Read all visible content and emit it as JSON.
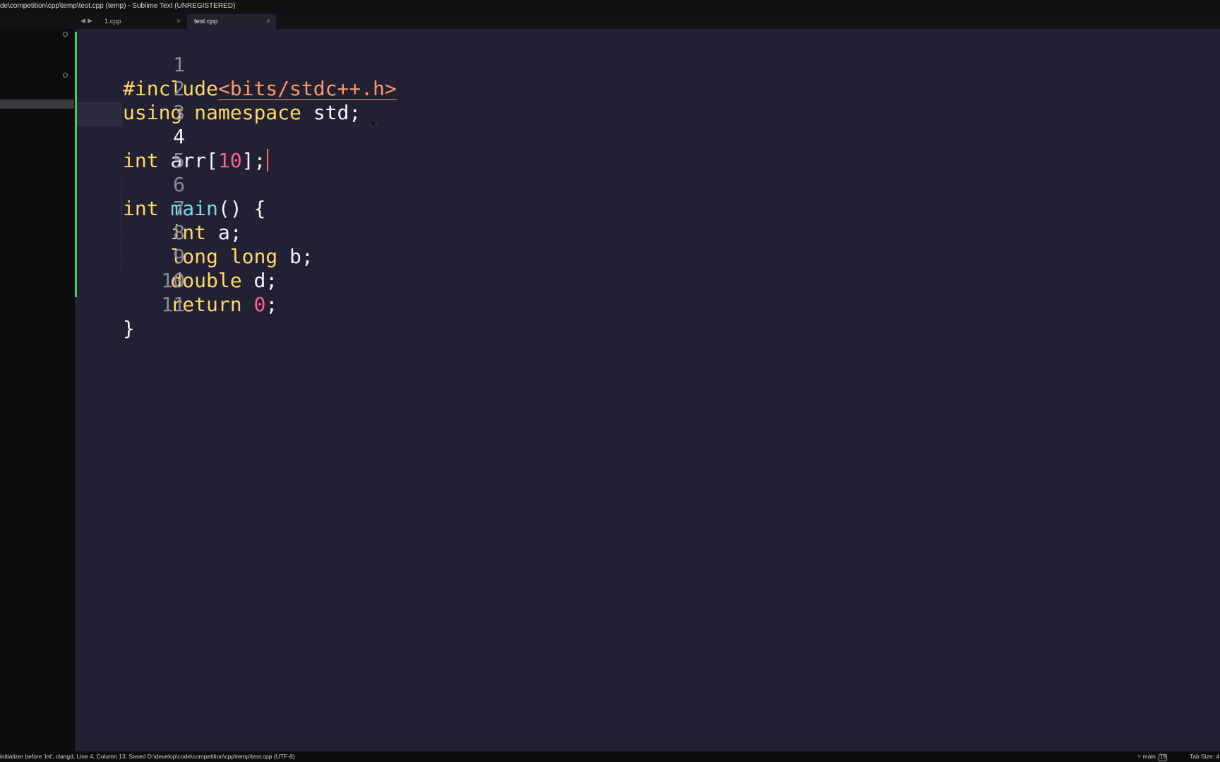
{
  "window": {
    "title": "de\\competition\\cpp\\temp\\test.cpp (temp) - Sublime Text (UNREGISTERED)"
  },
  "tabs": [
    {
      "label": "1.cpp",
      "close": "×",
      "active": false
    },
    {
      "label": "test.cpp",
      "close": "×",
      "active": true
    }
  ],
  "nav": {
    "back": "◀",
    "forward": "▶"
  },
  "editor": {
    "current_line": 4,
    "lines": [
      {
        "n": "1"
      },
      {
        "n": "2"
      },
      {
        "n": "3"
      },
      {
        "n": "4"
      },
      {
        "n": "5"
      },
      {
        "n": "6"
      },
      {
        "n": "7"
      },
      {
        "n": "8"
      },
      {
        "n": "9"
      },
      {
        "n": "10"
      },
      {
        "n": "11"
      }
    ],
    "tokens": {
      "l1_pp": "#include",
      "l1_hdr": "<bits/stdc++.h>",
      "l2_a": "using",
      "l2_b": "namespace",
      "l2_c": " std;",
      "l4_type": "int",
      "l4_name": " arr[",
      "l4_num": "10",
      "l4_end": "];",
      "l6_type": "int",
      "l6_fn": "main",
      "l6_rest": "() {",
      "l7_type": "int",
      "l7_rest": " a;",
      "l8_type1": "long",
      "l8_type2": "long",
      "l8_rest": " b;",
      "l9_type": "double",
      "l9_rest": " d;",
      "l10_kw": "return",
      "l10_num": "0",
      "l10_end": ";",
      "l11": "}"
    }
  },
  "colors": {
    "editor_bg": "#222033",
    "keyword": "#ffd866",
    "function": "#78dce8",
    "number": "#ff6188",
    "string": "#fc9867",
    "modified_bar": "#39d353"
  },
  "statusbar": {
    "left": "initializer before 'int', clangd, Line 4, Column 13; Saved D:\\develop\\code\\competition\\cpp\\temp\\test.cpp (UTF-8)",
    "branch_icon": "git-branch-icon",
    "branch": "main",
    "branch_count": "19",
    "tab_size": "Tab Size: 4"
  }
}
